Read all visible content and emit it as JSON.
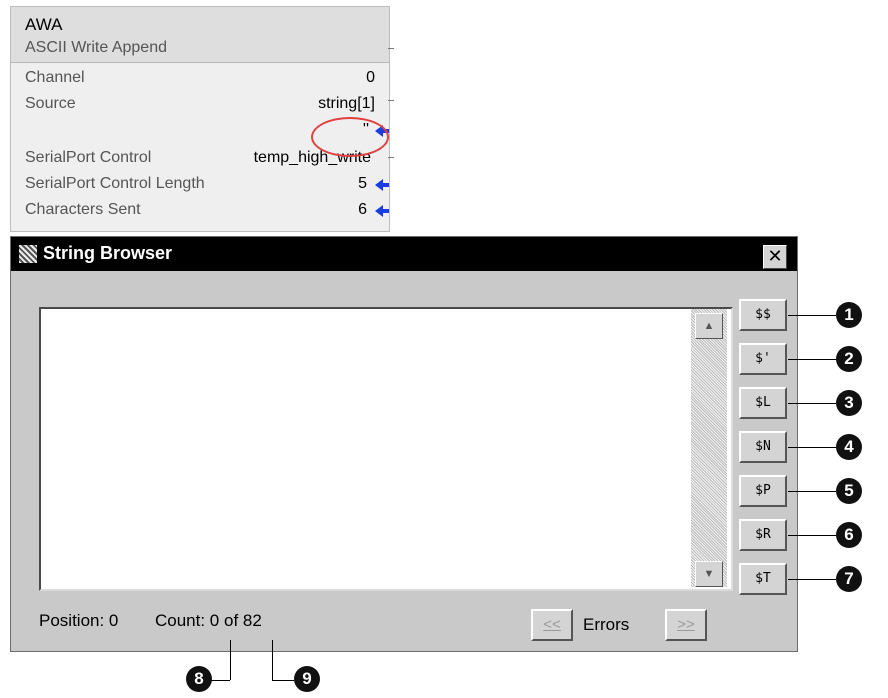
{
  "instruction": {
    "title": "AWA",
    "description": "ASCII Write Append",
    "rows": [
      {
        "label": "Channel",
        "value": "0"
      },
      {
        "label": "Source",
        "value": "string[1]"
      },
      {
        "label": "",
        "value": "''"
      },
      {
        "label": "SerialPort Control",
        "value": "temp_high_write"
      },
      {
        "label": "SerialPort Control Length",
        "value": "5"
      },
      {
        "label": "Characters Sent",
        "value": "6"
      }
    ]
  },
  "dialog": {
    "title": "String Browser",
    "close_label": "✕",
    "text_content": "",
    "buttons": [
      "$$",
      "$'",
      "$L",
      "$N",
      "$P",
      "$R",
      "$T"
    ],
    "status": {
      "position": "Position: 0",
      "count": "Count: 0 of 82"
    },
    "errors": {
      "prev": "<<",
      "label": "Errors",
      "next": ">>"
    }
  },
  "callouts": [
    "1",
    "2",
    "3",
    "4",
    "5",
    "6",
    "7",
    "8",
    "9"
  ],
  "icons": {
    "scroll_up": "scroll-up-arrow-icon",
    "scroll_down": "scroll-down-arrow-icon",
    "write_arrow": "blue-left-arrow-icon",
    "dialog_icon": "string-browser-app-icon"
  },
  "colors": {
    "arrow": "#1a3de0",
    "highlight": "#e04040",
    "titlebar": "#000000"
  }
}
